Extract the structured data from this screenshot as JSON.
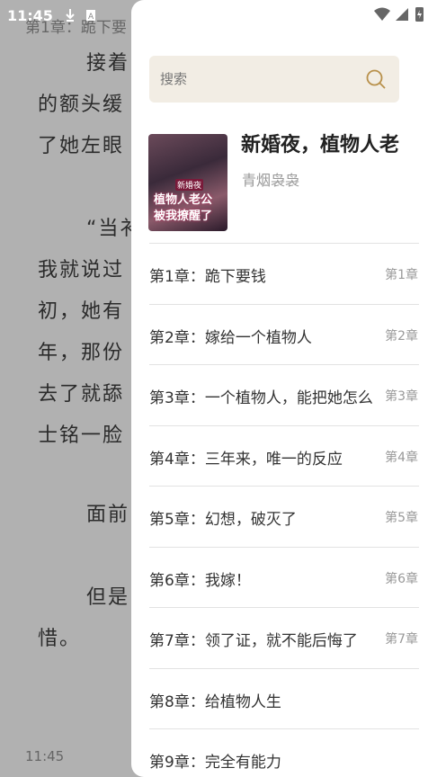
{
  "status_bar": {
    "time": "11:45"
  },
  "reader": {
    "chapter_heading": "第1章：跪下要",
    "lines": [
      "接着",
      "的额头缓",
      "了她左眼",
      "“当衤",
      "我就说过",
      "初，她有",
      "年，那份",
      "去了就舔",
      "士铭一脸",
      "面前",
      "但是",
      "惜。"
    ],
    "bottom_time": "11:45"
  },
  "drawer": {
    "search": {
      "placeholder": "搜索"
    },
    "book": {
      "title": "新婚夜，植物人老",
      "author": "青烟袅袅",
      "cover_text_top": "新婚夜",
      "cover_line1": "植物人老公",
      "cover_line2": "被我撩醒了"
    },
    "chapters": [
      {
        "title": "第1章：跪下要钱",
        "num": "第1章"
      },
      {
        "title": "第2章：嫁给一个植物人",
        "num": "第2章"
      },
      {
        "title": "第3章：一个植物人，能把她怎么",
        "num": "第3章"
      },
      {
        "title": "第4章：三年来，唯一的反应",
        "num": "第4章"
      },
      {
        "title": "第5章：幻想，破灭了",
        "num": "第5章"
      },
      {
        "title": "第6章：我嫁！",
        "num": "第6章"
      },
      {
        "title": "第7章：领了证，就不能后悔了",
        "num": "第7章"
      },
      {
        "title": "第8章：给植物人生",
        "num": ""
      },
      {
        "title": "第9章：完全有能力",
        "num": ""
      }
    ]
  }
}
